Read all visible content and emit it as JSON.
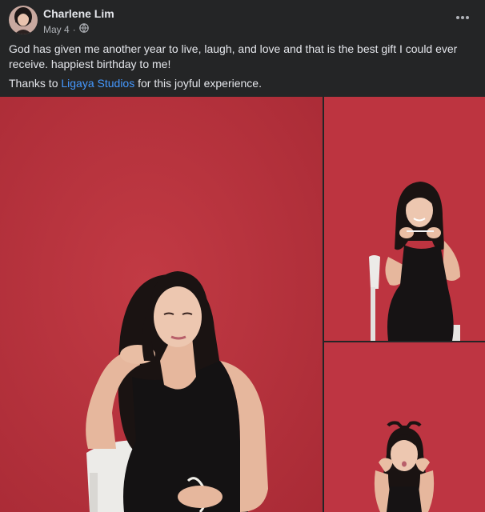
{
  "post": {
    "author": "Charlene Lim",
    "date": "May 4",
    "separator": "·",
    "audience_icon": "globe-icon",
    "more_icon": "more-options-icon",
    "caption_line1": "God has given me another year to live, laugh, and love and that is the best gift I could ever receive. happiest birthday to me!",
    "credit_prefix": "Thanks to ",
    "credit_link": "Ligaya Studios",
    "credit_suffix": " for this joyful experience."
  },
  "colors": {
    "background": "#242526",
    "text_primary": "#e4e6eb",
    "text_secondary": "#b0b3b8",
    "link": "#4599ff",
    "photo_backdrop": "#b8323d"
  },
  "photos": [
    {
      "name": "photo-main"
    },
    {
      "name": "photo-top-right"
    },
    {
      "name": "photo-bottom-right"
    }
  ]
}
